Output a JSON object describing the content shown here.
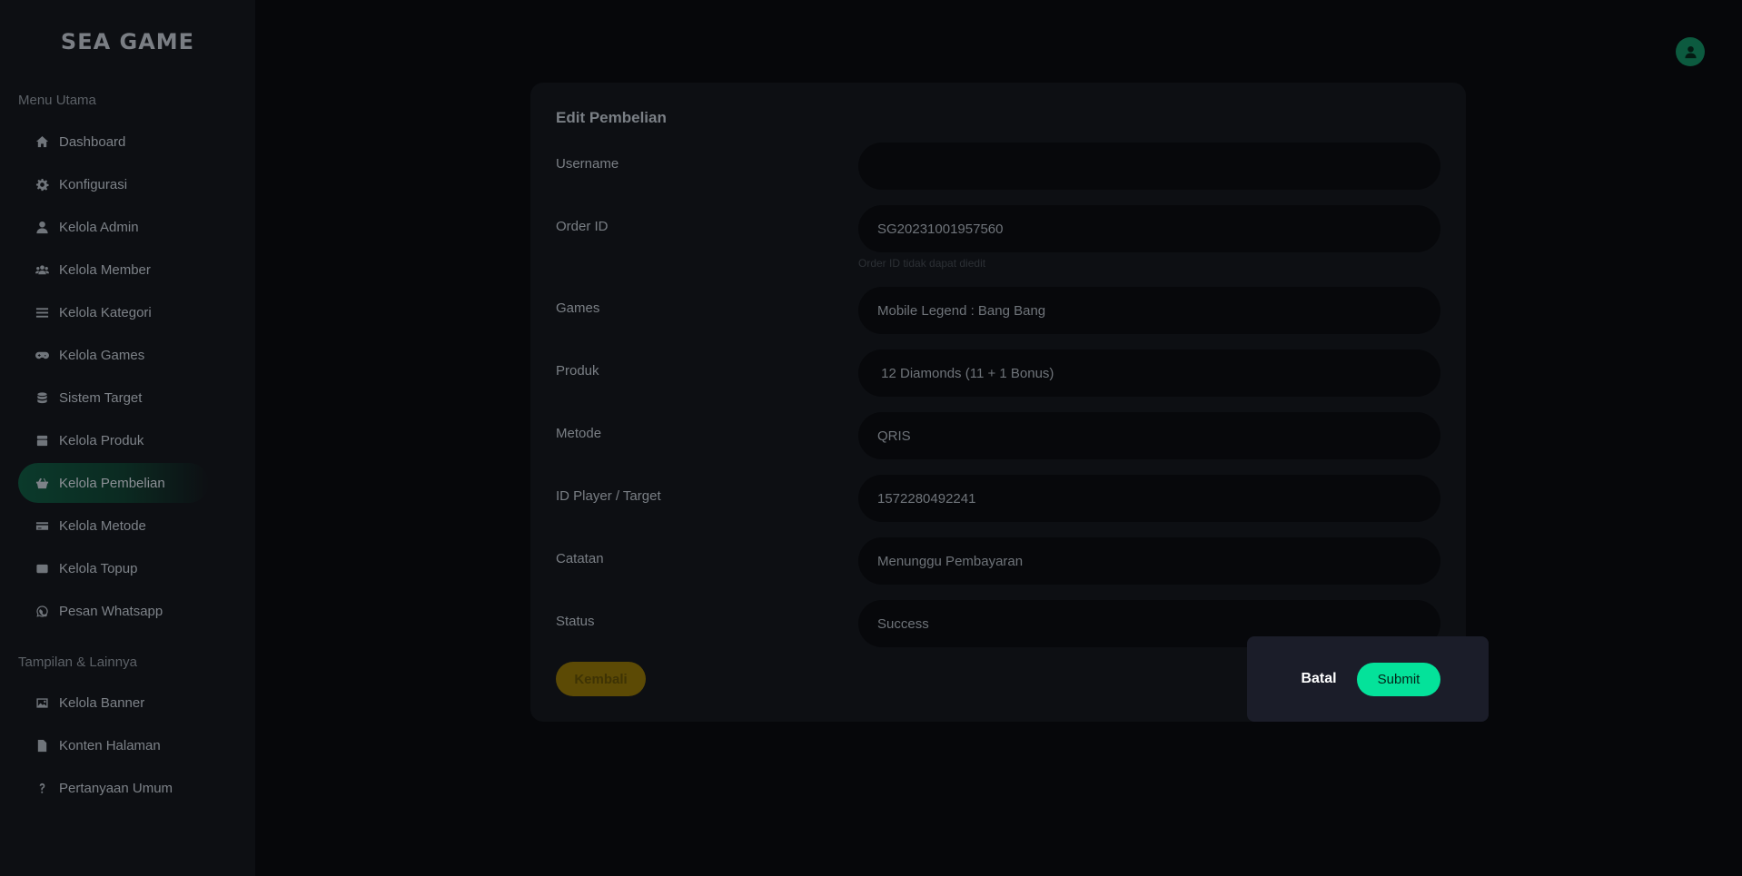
{
  "brand": {
    "logo_text": "SEA GAME"
  },
  "sidebar": {
    "section_main": "Menu Utama",
    "section_other": "Tampilan & Lainnya",
    "items": [
      {
        "label": "Dashboard",
        "icon": "home-icon"
      },
      {
        "label": "Konfigurasi",
        "icon": "gear-icon"
      },
      {
        "label": "Kelola Admin",
        "icon": "user-icon"
      },
      {
        "label": "Kelola Member",
        "icon": "users-icon"
      },
      {
        "label": "Kelola Kategori",
        "icon": "list-icon"
      },
      {
        "label": "Kelola Games",
        "icon": "gamepad-icon"
      },
      {
        "label": "Sistem Target",
        "icon": "database-icon"
      },
      {
        "label": "Kelola Produk",
        "icon": "box-icon"
      },
      {
        "label": "Kelola Pembelian",
        "icon": "basket-icon",
        "active": true
      },
      {
        "label": "Kelola Metode",
        "icon": "credit-card-icon"
      },
      {
        "label": "Kelola Topup",
        "icon": "wallet-icon"
      },
      {
        "label": "Pesan Whatsapp",
        "icon": "whatsapp-icon"
      }
    ],
    "items_other": [
      {
        "label": "Kelola Banner",
        "icon": "image-icon"
      },
      {
        "label": "Konten Halaman",
        "icon": "file-icon"
      },
      {
        "label": "Pertanyaan Umum",
        "icon": "question-icon"
      }
    ]
  },
  "form": {
    "title": "Edit Pembelian",
    "fields": {
      "username": {
        "label": "Username",
        "value": ""
      },
      "order_id": {
        "label": "Order ID",
        "value": "SG20231001957560",
        "hint": "Order ID tidak dapat diedit"
      },
      "games": {
        "label": "Games",
        "value": "Mobile Legend : Bang Bang"
      },
      "produk": {
        "label": "Produk",
        "value": " 12 Diamonds (11 + 1 Bonus)"
      },
      "metode": {
        "label": "Metode",
        "value": "QRIS"
      },
      "id_player": {
        "label": "ID Player / Target",
        "value": "1572280492241"
      },
      "catatan": {
        "label": "Catatan",
        "value": "Menunggu Pembayaran"
      },
      "status": {
        "label": "Status",
        "value": "Success"
      }
    },
    "back_label": "Kembali"
  },
  "confirm": {
    "cancel_label": "Batal",
    "submit_label": "Submit"
  },
  "colors": {
    "accent": "#04e29a",
    "back_button": "#5c4a05",
    "avatar": "#0c5a3f"
  }
}
